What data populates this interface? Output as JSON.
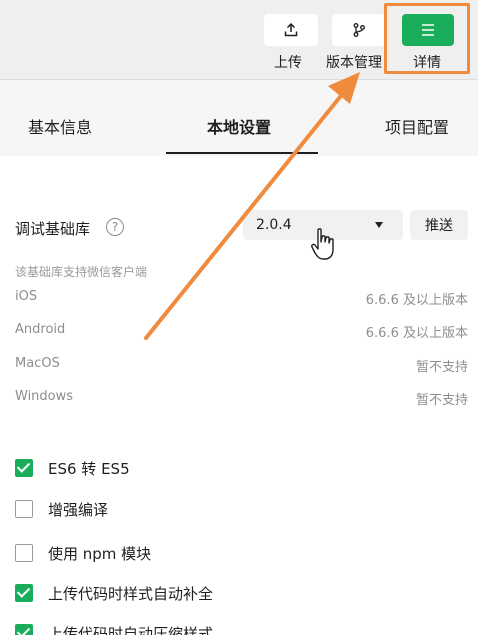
{
  "toolbar": {
    "upload_label": "上传",
    "version_label": "版本管理",
    "details_label": "详情"
  },
  "tabs": [
    {
      "label": "基本信息"
    },
    {
      "label": "本地设置"
    },
    {
      "label": "项目配置"
    }
  ],
  "base_library": {
    "label": "调试基础库",
    "help_glyph": "?",
    "selected_version": "2.0.4",
    "push_label": "推送",
    "hint": "该基础库支持微信客户端"
  },
  "support_table": [
    {
      "os": "iOS",
      "version": "6.6.6 及以上版本"
    },
    {
      "os": "Android",
      "version": "6.6.6 及以上版本"
    },
    {
      "os": "MacOS",
      "version": "暂不支持"
    },
    {
      "os": "Windows",
      "version": "暂不支持"
    }
  ],
  "options": [
    {
      "label": "ES6 转 ES5",
      "checked": true
    },
    {
      "label": "增强编译",
      "checked": false
    },
    {
      "label": "使用 npm 模块",
      "checked": false
    },
    {
      "label": "上传代码时样式自动补全",
      "checked": true
    },
    {
      "label": "上传代码时自动压缩样式",
      "checked": true
    }
  ],
  "colors": {
    "accent_green": "#1aad5c",
    "annotation_orange": "#f08a3c"
  },
  "icons": [
    "upload-icon",
    "branch-icon",
    "menu-icon",
    "help-icon",
    "dropdown-caret-icon",
    "hand-cursor-icon",
    "annotation-arrow"
  ]
}
